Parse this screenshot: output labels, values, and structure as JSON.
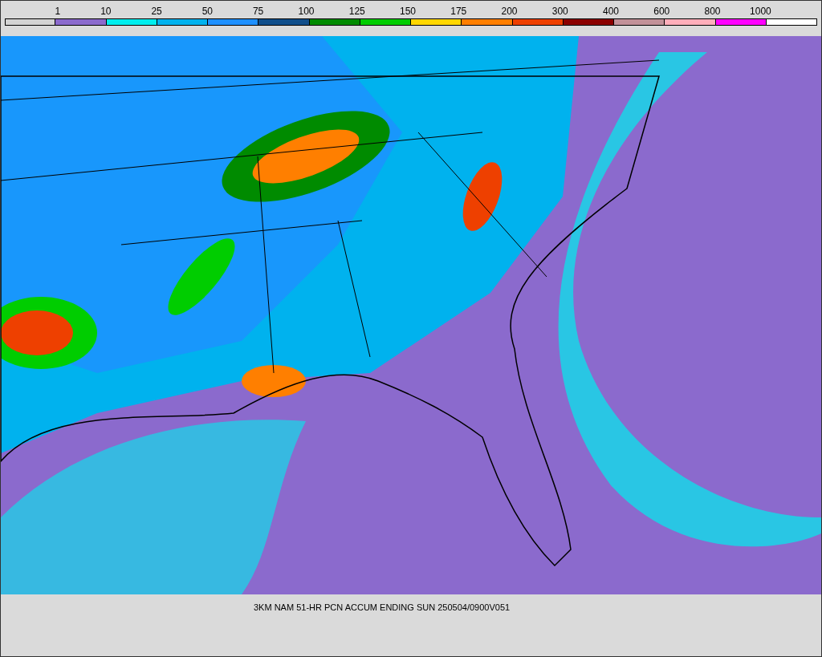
{
  "legend": [
    {
      "label": "1",
      "color": "#d3d3d3"
    },
    {
      "label": "10",
      "color": "#8b6acd"
    },
    {
      "label": "25",
      "color": "#00eeee"
    },
    {
      "label": "50",
      "color": "#00b2ee"
    },
    {
      "label": "75",
      "color": "#1e90ff"
    },
    {
      "label": "100",
      "color": "#104e8b"
    },
    {
      "label": "125",
      "color": "#008b00"
    },
    {
      "label": "150",
      "color": "#00cd00"
    },
    {
      "label": "175",
      "color": "#ffd700"
    },
    {
      "label": "200",
      "color": "#ff7f00"
    },
    {
      "label": "300",
      "color": "#ee4000"
    },
    {
      "label": "400",
      "color": "#8b0000"
    },
    {
      "label": "600",
      "color": "#c29199"
    },
    {
      "label": "800",
      "color": "#ffaebb"
    },
    {
      "label": "1000",
      "color": "#ff00ff"
    },
    {
      "color": "#ffffff"
    }
  ],
  "caption": "3KM NAM 51-HR PCN ACCUM ENDING SUN 250504/0900V051"
}
